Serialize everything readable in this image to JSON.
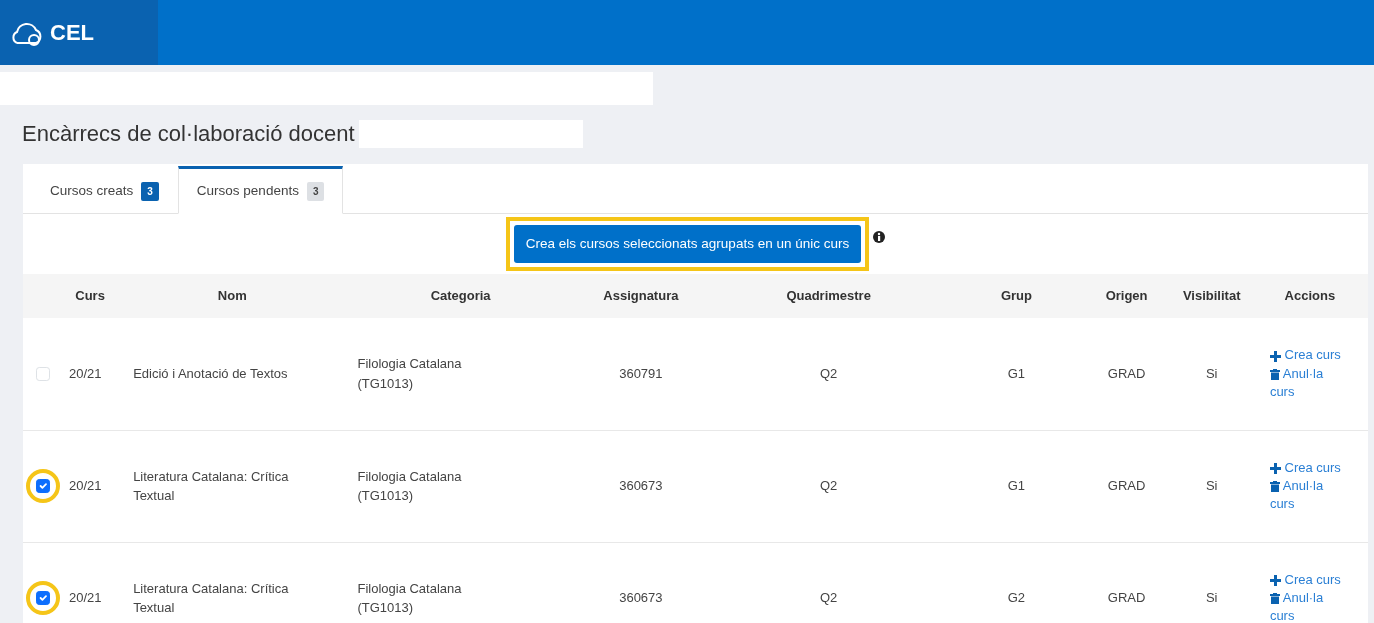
{
  "header": {
    "logo_text": "CEL"
  },
  "page_title": "Encàrrecs de col·laboració docent",
  "tabs": [
    {
      "label": "Cursos creats",
      "count": "3",
      "selected": false
    },
    {
      "label": "Cursos pendents",
      "count": "3",
      "selected": true
    }
  ],
  "group_button": {
    "label": "Crea els cursos seleccionats agrupats en un únic curs",
    "highlighted": true
  },
  "table": {
    "columns": [
      "Curs",
      "Nom",
      "Categoria",
      "Assignatura",
      "Quadrimestre",
      "Grup",
      "Origen",
      "Visibilitat",
      "Accions"
    ],
    "rows": [
      {
        "checked": false,
        "highlighted": false,
        "curs": "20/21",
        "nom": "Edició i Anotació de Textos",
        "categoria": "Filologia Catalana (TG1013)",
        "assignatura": "360791",
        "quadrimestre": "Q2",
        "grup": "G1",
        "origen": "GRAD",
        "visibilitat": "Si",
        "actions": [
          "Crea curs",
          "Anul·la curs"
        ]
      },
      {
        "checked": true,
        "highlighted": true,
        "curs": "20/21",
        "nom": "Literatura Catalana: Crítica Textual",
        "categoria": "Filologia Catalana (TG1013)",
        "assignatura": "360673",
        "quadrimestre": "Q2",
        "grup": "G1",
        "origen": "GRAD",
        "visibilitat": "Si",
        "actions": [
          "Crea curs",
          "Anul·la curs"
        ]
      },
      {
        "checked": true,
        "highlighted": true,
        "curs": "20/21",
        "nom": "Literatura Catalana: Crítica Textual",
        "categoria": "Filologia Catalana (TG1013)",
        "assignatura": "360673",
        "quadrimestre": "Q2",
        "grup": "G2",
        "origen": "GRAD",
        "visibilitat": "Si",
        "actions": [
          "Crea curs",
          "Anul·la curs"
        ]
      }
    ]
  }
}
